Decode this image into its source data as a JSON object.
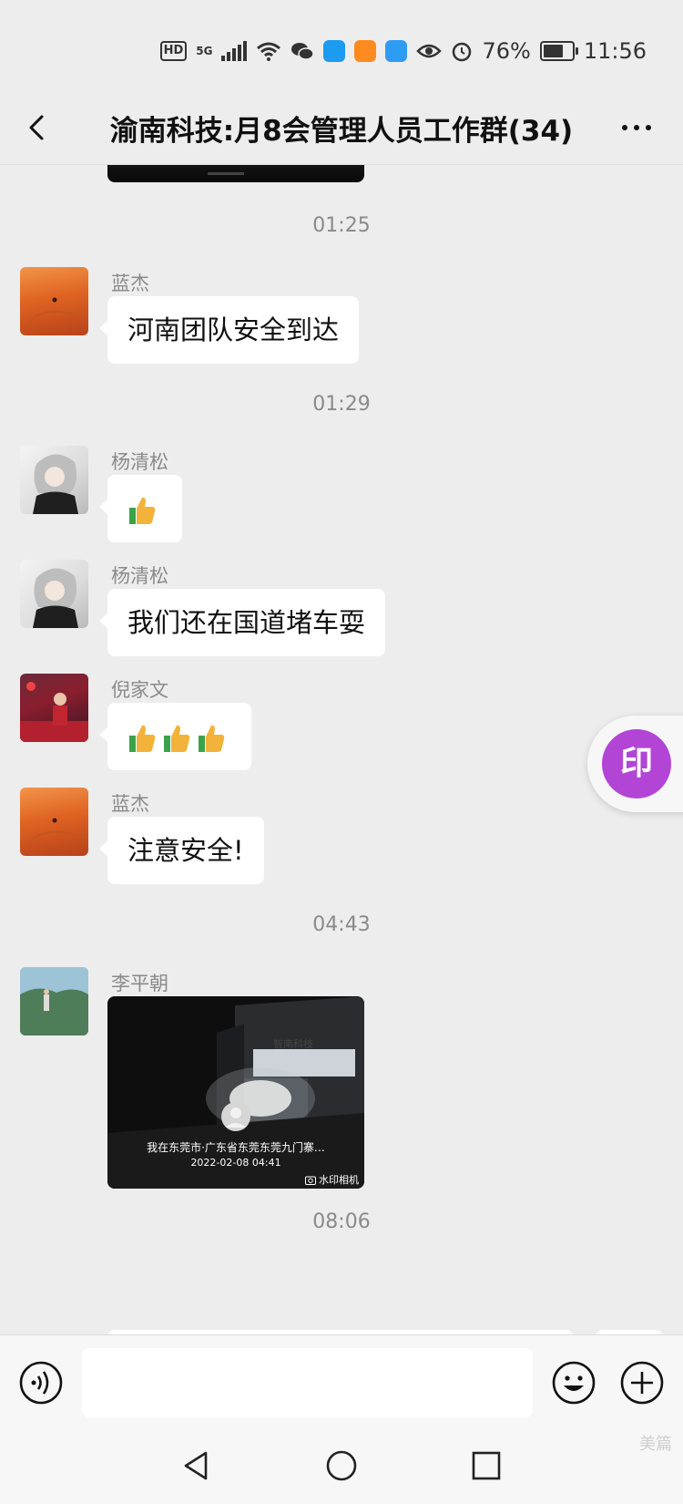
{
  "status_bar": {
    "hd_label": "HD",
    "network_label": "5G",
    "battery_percent": "76%",
    "battery_level": 0.76,
    "time": "11:56",
    "icons": [
      "signal-icon",
      "wifi-icon",
      "wechat-icon",
      "app-blue-icon",
      "app-orange-icon",
      "cloud-icon",
      "eye-icon",
      "alarm-icon",
      "battery-icon"
    ]
  },
  "header": {
    "title": "渝南科技:月8会管理人员工作群(34)"
  },
  "chat": {
    "timestamps": [
      "01:25",
      "01:29",
      "04:43",
      "08:06"
    ],
    "messages": [
      {
        "sender": "蓝杰",
        "text": "河南团队安全到达"
      },
      {
        "sender": "杨清松",
        "emoji_count": 1
      },
      {
        "sender": "杨清松",
        "text": "我们还在国道堵车耍"
      },
      {
        "sender": "倪家文",
        "emoji_count": 3
      },
      {
        "sender": "蓝杰",
        "text": "注意安全!"
      },
      {
        "sender": "李平朝",
        "image": {
          "location_caption": "我在东莞市·广东省东莞东莞九门寨…",
          "datetime": "2022-02-08 04:41",
          "camera_label": "水印相机",
          "sign_text": "智南科技"
        }
      }
    ]
  },
  "float_button": {
    "label": "印"
  },
  "input_bar": {
    "placeholder": ""
  },
  "watermark": {
    "text": "美篇"
  }
}
